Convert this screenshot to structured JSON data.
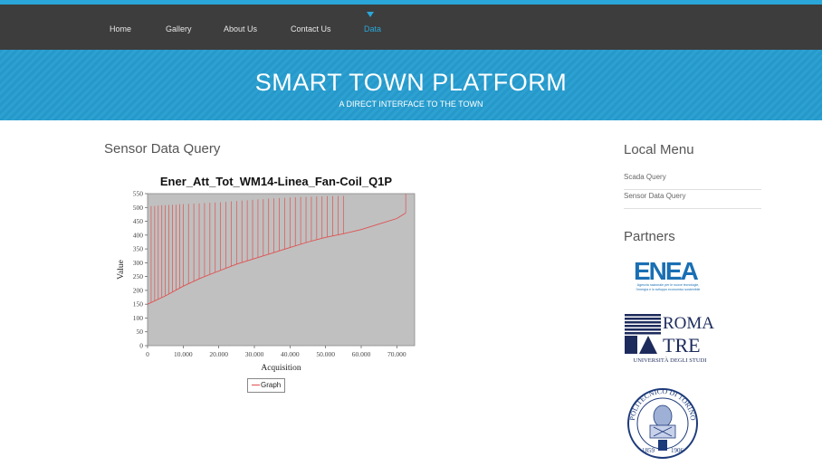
{
  "nav": {
    "items": [
      {
        "label": "Home"
      },
      {
        "label": "Gallery"
      },
      {
        "label": "About Us"
      },
      {
        "label": "Contact Us"
      },
      {
        "label": "Data"
      }
    ]
  },
  "banner": {
    "title": "SMART TOWN PLATFORM",
    "subtitle": "A DIRECT INTERFACE TO THE TOWN"
  },
  "main": {
    "title": "Sensor Data Query"
  },
  "chart_data": {
    "type": "line",
    "title": "Ener_Att_Tot_WM14-Linea_Fan-Coil_Q1P",
    "xlabel": "Acquisition",
    "ylabel": "Value",
    "xlim": [
      0,
      75000
    ],
    "ylim": [
      0,
      550
    ],
    "xticks": [
      "0",
      "10.000",
      "20.000",
      "30.000",
      "40.000",
      "50.000",
      "60.000",
      "70.000"
    ],
    "yticks": [
      "0",
      "50",
      "100",
      "150",
      "200",
      "250",
      "300",
      "350",
      "400",
      "450",
      "500",
      "550"
    ],
    "series": [
      {
        "name": "Graph",
        "color": "#e05050",
        "baseline": {
          "x": [
            0,
            5000,
            10000,
            15000,
            20000,
            25000,
            30000,
            35000,
            40000,
            45000,
            50000,
            55000,
            60000,
            65000,
            70000,
            72500
          ],
          "y": [
            150,
            180,
            215,
            245,
            270,
            295,
            315,
            335,
            355,
            375,
            392,
            405,
            420,
            440,
            460,
            480
          ]
        },
        "spikes": [
          {
            "x": 1000,
            "to": 505
          },
          {
            "x": 2000,
            "to": 505
          },
          {
            "x": 3000,
            "to": 507
          },
          {
            "x": 4000,
            "to": 508
          },
          {
            "x": 5000,
            "to": 508
          },
          {
            "x": 6000,
            "to": 509
          },
          {
            "x": 7000,
            "to": 510
          },
          {
            "x": 8000,
            "to": 510
          },
          {
            "x": 9000,
            "to": 512
          },
          {
            "x": 10000,
            "to": 512
          },
          {
            "x": 11500,
            "to": 513
          },
          {
            "x": 13000,
            "to": 514
          },
          {
            "x": 14500,
            "to": 515
          },
          {
            "x": 16000,
            "to": 516
          },
          {
            "x": 17500,
            "to": 517
          },
          {
            "x": 19000,
            "to": 518
          },
          {
            "x": 20500,
            "to": 519
          },
          {
            "x": 22000,
            "to": 520
          },
          {
            "x": 23500,
            "to": 522
          },
          {
            "x": 25000,
            "to": 523
          },
          {
            "x": 26500,
            "to": 525
          },
          {
            "x": 28000,
            "to": 526
          },
          {
            "x": 29500,
            "to": 528
          },
          {
            "x": 31000,
            "to": 529
          },
          {
            "x": 32500,
            "to": 530
          },
          {
            "x": 34000,
            "to": 532
          },
          {
            "x": 35500,
            "to": 533
          },
          {
            "x": 37000,
            "to": 534
          },
          {
            "x": 38500,
            "to": 535
          },
          {
            "x": 40000,
            "to": 536
          },
          {
            "x": 41500,
            "to": 537
          },
          {
            "x": 43000,
            "to": 538
          },
          {
            "x": 44500,
            "to": 538
          },
          {
            "x": 46000,
            "to": 539
          },
          {
            "x": 47500,
            "to": 540
          },
          {
            "x": 49000,
            "to": 540
          },
          {
            "x": 50500,
            "to": 541
          },
          {
            "x": 52000,
            "to": 541
          },
          {
            "x": 53500,
            "to": 542
          },
          {
            "x": 55000,
            "to": 542
          },
          {
            "x": 72500,
            "to": 550
          }
        ]
      }
    ],
    "legend": "bottom-center",
    "background": "#c0c0c0"
  },
  "legend": {
    "label": "Graph"
  },
  "sidebar": {
    "menu_title": "Local Menu",
    "menu_items": [
      {
        "label": "Scada Query"
      },
      {
        "label": "Sensor Data Query"
      }
    ],
    "partners_title": "Partners",
    "partners": [
      {
        "name": "ENEA",
        "caption_line1": "Agenzia nazionale per le nuove tecnologie,",
        "caption_line2": "l'energia e lo sviluppo economico sostenibile"
      },
      {
        "name_line1": "ROMA",
        "name_line2": "TRE",
        "caption": "UNIVERSITÀ DEGLI STUDI"
      },
      {
        "name": "POLITECNICO DI TORINO",
        "years": [
          "1859",
          "1906"
        ]
      }
    ]
  }
}
